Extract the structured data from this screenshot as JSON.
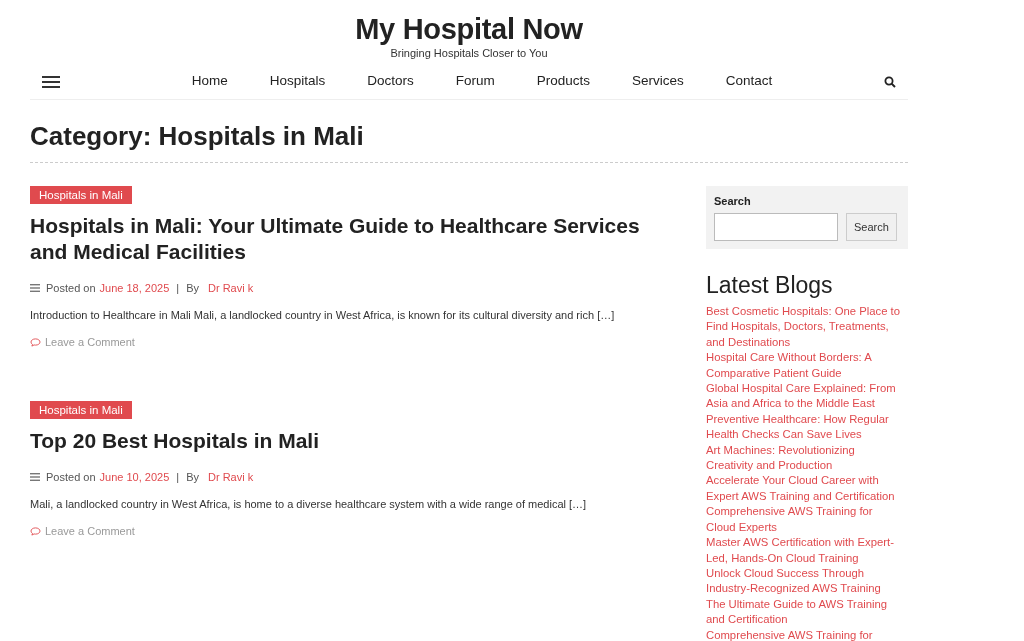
{
  "site": {
    "title": "My Hospital Now",
    "tagline": "Bringing Hospitals Closer to You"
  },
  "nav": {
    "items": [
      "Home",
      "Hospitals",
      "Doctors",
      "Forum",
      "Products",
      "Services",
      "Contact"
    ]
  },
  "page_title": "Category: Hospitals in Mali",
  "posts": [
    {
      "category": "Hospitals in Mali",
      "title": "Hospitals in Mali: Your Ultimate Guide to Healthcare Services and Medical Facilities",
      "posted_label": "Posted on",
      "date": "June 18, 2025",
      "separator": "|",
      "by_label": "By",
      "author": "Dr Ravi k",
      "excerpt": "Introduction to Healthcare in Mali Mali, a landlocked country in West Africa, is known for its cultural diversity and rich […]",
      "comment_link": "Leave a Comment"
    },
    {
      "category": "Hospitals in Mali",
      "title": "Top 20 Best Hospitals in Mali",
      "posted_label": "Posted on",
      "date": "June 10, 2025",
      "separator": "|",
      "by_label": "By",
      "author": "Dr Ravi k",
      "excerpt": "Mali, a landlocked country in West Africa, is home to a diverse healthcare system with a wide range of medical […]",
      "comment_link": "Leave a Comment"
    }
  ],
  "sidebar": {
    "search": {
      "label": "Search",
      "button": "Search"
    },
    "latest_blogs": {
      "heading": "Latest Blogs",
      "links": [
        "Best Cosmetic Hospitals: One Place to Find Hospitals, Doctors, Treatments, and Destinations",
        "Hospital Care Without Borders: A Comparative Patient Guide",
        "Global Hospital Care Explained: From Asia and Africa to the Middle East",
        "Preventive Healthcare: How Regular Health Checks Can Save Lives",
        "Art Machines: Revolutionizing Creativity and Production",
        "Accelerate Your Cloud Career with Expert AWS Training and Certification",
        "Comprehensive AWS Training for Cloud Experts",
        "Master AWS Certification with Expert-Led, Hands-On Cloud Training",
        "Unlock Cloud Success Through Industry-Recognized AWS Training",
        "The Ultimate Guide to AWS Training and Certification",
        "Comprehensive AWS Training for"
      ]
    }
  }
}
